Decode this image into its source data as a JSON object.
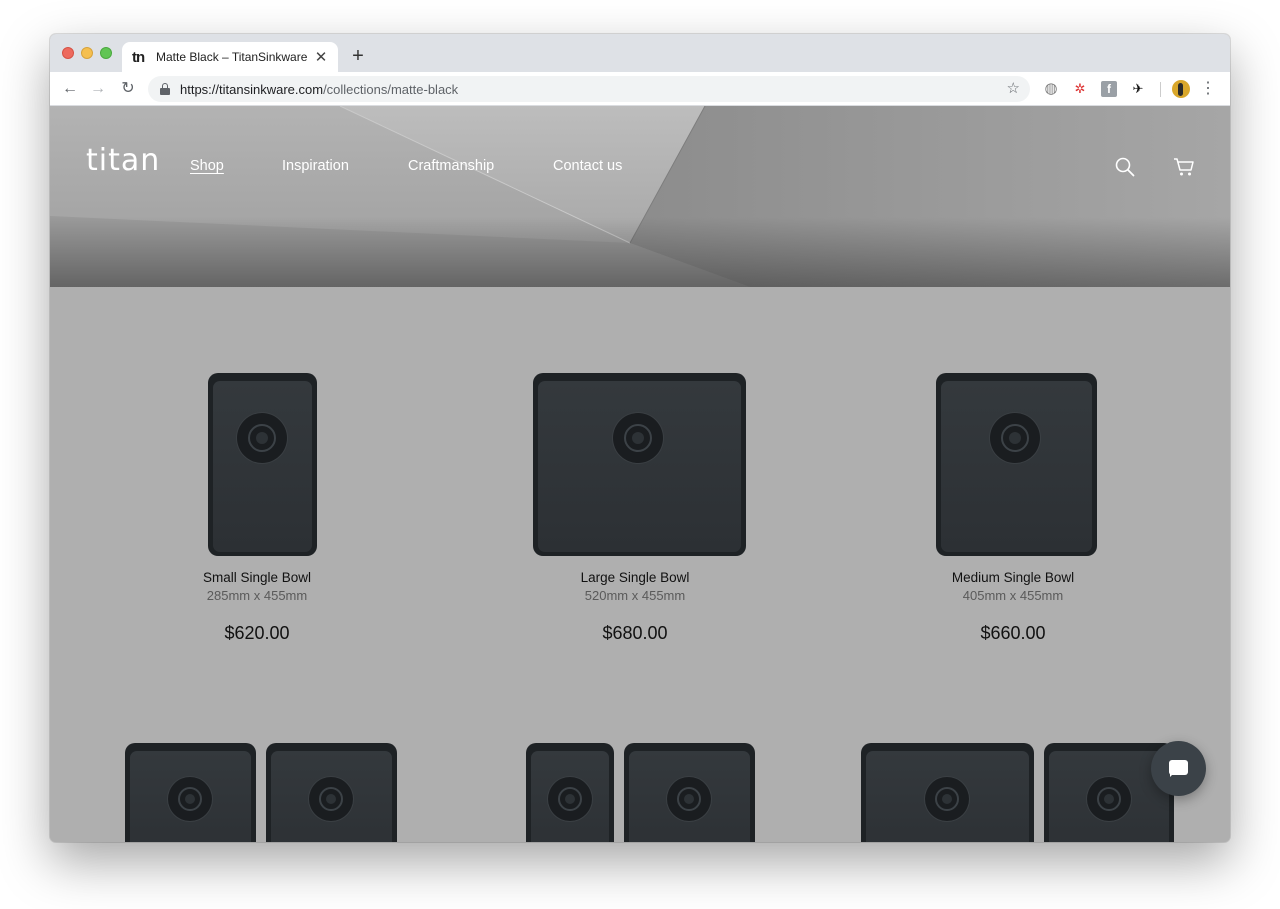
{
  "browser": {
    "tab_title": "Matte Black – TitanSinkware",
    "tab_favicon": "tn",
    "url_host": "https://titansinkware.com",
    "url_path": "/collections/matte-black",
    "tab_close_icon": "close-icon",
    "new_tab_icon": "plus-icon",
    "back_icon": "arrow-left-icon",
    "forward_icon": "arrow-right-icon",
    "reload_icon": "reload-icon",
    "bookmark_icon": "star-icon",
    "extensions": [
      "globe-icon",
      "color-wheel-icon",
      "facebook-icon",
      "bird-icon"
    ],
    "menu_icon": "kebab-menu-icon"
  },
  "site": {
    "logo": "titan",
    "nav": {
      "shop": "Shop",
      "inspiration": "Inspiration",
      "craftsmanship": "Craftmanship",
      "contact": "Contact us"
    },
    "search_icon": "search-icon",
    "cart_icon": "cart-icon"
  },
  "products": [
    {
      "name": "Small Single Bowl",
      "dims": "285mm x 455mm",
      "price": "$620.00"
    },
    {
      "name": "Large Single Bowl",
      "dims": "520mm x 455mm",
      "price": "$680.00"
    },
    {
      "name": "Medium Single Bowl",
      "dims": "405mm x 455mm",
      "price": "$660.00"
    }
  ],
  "chat_icon": "chat-bubble-icon",
  "colors": {
    "page_bg": "#afafaf",
    "sink": "#1e2225",
    "chat_button": "#3b4248"
  }
}
